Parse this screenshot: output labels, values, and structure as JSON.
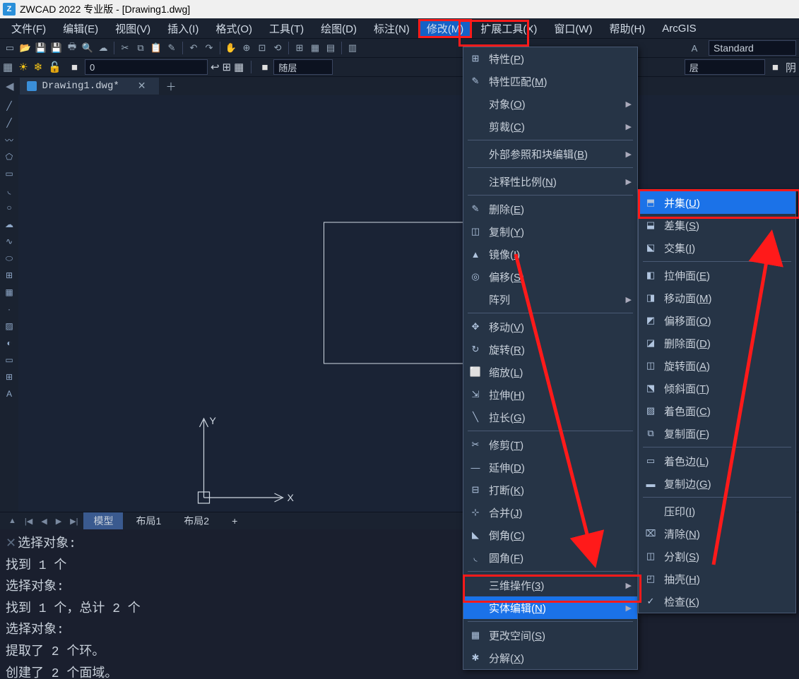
{
  "titlebar": {
    "app": "ZWCAD 2022 专业版",
    "doc": "[Drawing1.dwg]"
  },
  "menubar": {
    "items": [
      "文件(F)",
      "编辑(E)",
      "视图(V)",
      "插入(I)",
      "格式(O)",
      "工具(T)",
      "绘图(D)",
      "标注(N)",
      "修改(M)",
      "扩展工具(X)",
      "窗口(W)",
      "帮助(H)",
      "ArcGIS"
    ]
  },
  "layerbar": {
    "layername": "0",
    "follow": "随层",
    "style": "Standard",
    "follow2": "阴"
  },
  "tab": {
    "name": "Drawing1.dwg*"
  },
  "bottomtabs": {
    "items": [
      "模型",
      "布局1",
      "布局2"
    ]
  },
  "cmd": {
    "lines": [
      "选择对象:",
      "找到 1 个",
      "选择对象:",
      "找到 1 个，总计 2 个",
      "选择对象:",
      "提取了 2 个环。",
      "创建了 2 个面域。"
    ]
  },
  "modify_menu": {
    "items": [
      {
        "icon": "⊞",
        "label": "特性",
        "u": "P"
      },
      {
        "icon": "✎",
        "label": "特性匹配",
        "u": "M"
      },
      {
        "icon": "",
        "label": "对象",
        "u": "O",
        "sub": true
      },
      {
        "icon": "",
        "label": "剪裁",
        "u": "C",
        "sub": true
      },
      {
        "sep": true
      },
      {
        "icon": "",
        "label": "外部参照和块编辑",
        "u": "B",
        "sub": true
      },
      {
        "sep": true
      },
      {
        "icon": "",
        "label": "注释性比例",
        "u": "N",
        "sub": true
      },
      {
        "sep": true
      },
      {
        "icon": "✎",
        "label": "删除",
        "u": "E"
      },
      {
        "icon": "◫",
        "label": "复制",
        "u": "Y"
      },
      {
        "icon": "▲",
        "label": "镜像",
        "u": "I"
      },
      {
        "icon": "◎",
        "label": "偏移",
        "u": "S"
      },
      {
        "icon": "",
        "label": "阵列",
        "sub": true
      },
      {
        "sep": true
      },
      {
        "icon": "✥",
        "label": "移动",
        "u": "V"
      },
      {
        "icon": "↻",
        "label": "旋转",
        "u": "R"
      },
      {
        "icon": "⬜",
        "label": "缩放",
        "u": "L"
      },
      {
        "icon": "⇲",
        "label": "拉伸",
        "u": "H"
      },
      {
        "icon": "╲",
        "label": "拉长",
        "u": "G"
      },
      {
        "sep": true
      },
      {
        "icon": "✂",
        "label": "修剪",
        "u": "T"
      },
      {
        "icon": "—",
        "label": "延伸",
        "u": "D"
      },
      {
        "icon": "⊟",
        "label": "打断",
        "u": "K"
      },
      {
        "icon": "⊹",
        "label": "合并",
        "u": "J"
      },
      {
        "icon": "◣",
        "label": "倒角",
        "u": "C"
      },
      {
        "icon": "◟",
        "label": "圆角",
        "u": "F"
      },
      {
        "sep": true
      },
      {
        "icon": "",
        "label": "三维操作",
        "u": "3",
        "sub": true
      },
      {
        "icon": "",
        "label": "实体编辑",
        "u": "N",
        "sub": true,
        "sel": true
      },
      {
        "sep": true
      },
      {
        "icon": "▦",
        "label": "更改空间",
        "u": "S"
      },
      {
        "icon": "✱",
        "label": "分解",
        "u": "X"
      }
    ]
  },
  "solid_menu": {
    "items": [
      {
        "icon": "⬒",
        "label": "并集",
        "u": "U",
        "sel": true
      },
      {
        "icon": "⬓",
        "label": "差集",
        "u": "S"
      },
      {
        "icon": "⬕",
        "label": "交集",
        "u": "I"
      },
      {
        "sep": true
      },
      {
        "icon": "◧",
        "label": "拉伸面",
        "u": "E"
      },
      {
        "icon": "◨",
        "label": "移动面",
        "u": "M"
      },
      {
        "icon": "◩",
        "label": "偏移面",
        "u": "O"
      },
      {
        "icon": "◪",
        "label": "删除面",
        "u": "D"
      },
      {
        "icon": "◫",
        "label": "旋转面",
        "u": "A"
      },
      {
        "icon": "⬔",
        "label": "倾斜面",
        "u": "T"
      },
      {
        "icon": "▨",
        "label": "着色面",
        "u": "C"
      },
      {
        "icon": "⧉",
        "label": "复制面",
        "u": "F"
      },
      {
        "sep": true
      },
      {
        "icon": "▭",
        "label": "着色边",
        "u": "L"
      },
      {
        "icon": "▬",
        "label": "复制边",
        "u": "G"
      },
      {
        "sep": true
      },
      {
        "icon": "",
        "label": "压印",
        "u": "I"
      },
      {
        "icon": "⌧",
        "label": "清除",
        "u": "N"
      },
      {
        "icon": "◫",
        "label": "分割",
        "u": "S"
      },
      {
        "icon": "◰",
        "label": "抽壳",
        "u": "H"
      },
      {
        "icon": "✓",
        "label": "检查",
        "u": "K"
      }
    ]
  }
}
